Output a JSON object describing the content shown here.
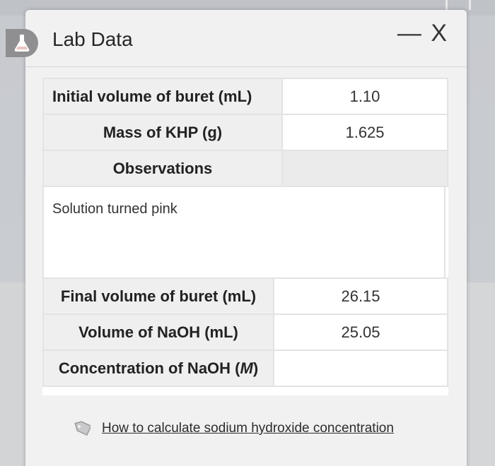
{
  "window": {
    "title": "Lab Data",
    "minimize_label": "—",
    "close_label": "X",
    "icon": "flask-icon"
  },
  "table_top": {
    "rows": [
      {
        "label": "Initial volume of buret (mL)",
        "value": "1.10"
      },
      {
        "label": "Mass of KHP (g)",
        "value": "1.625"
      },
      {
        "label": "Observations",
        "value": ""
      }
    ]
  },
  "observations": {
    "text": "Solution turned pink"
  },
  "table_bottom": {
    "rows": [
      {
        "label": "Final volume of buret (mL)",
        "value": "26.15"
      },
      {
        "label": "Volume of NaOH (mL)",
        "value": "25.05"
      },
      {
        "label_prefix": "Concentration of NaOH (",
        "label_unit": "M",
        "label_suffix": ")",
        "value": ""
      }
    ]
  },
  "help_link": {
    "icon": "tag-icon",
    "text": "How to calculate sodium hydroxide concentration"
  },
  "colors": {
    "panel_bg": "#f1f1f2",
    "label_cell_bg": "#efeff0",
    "badge_bg": "#8f8f92"
  }
}
